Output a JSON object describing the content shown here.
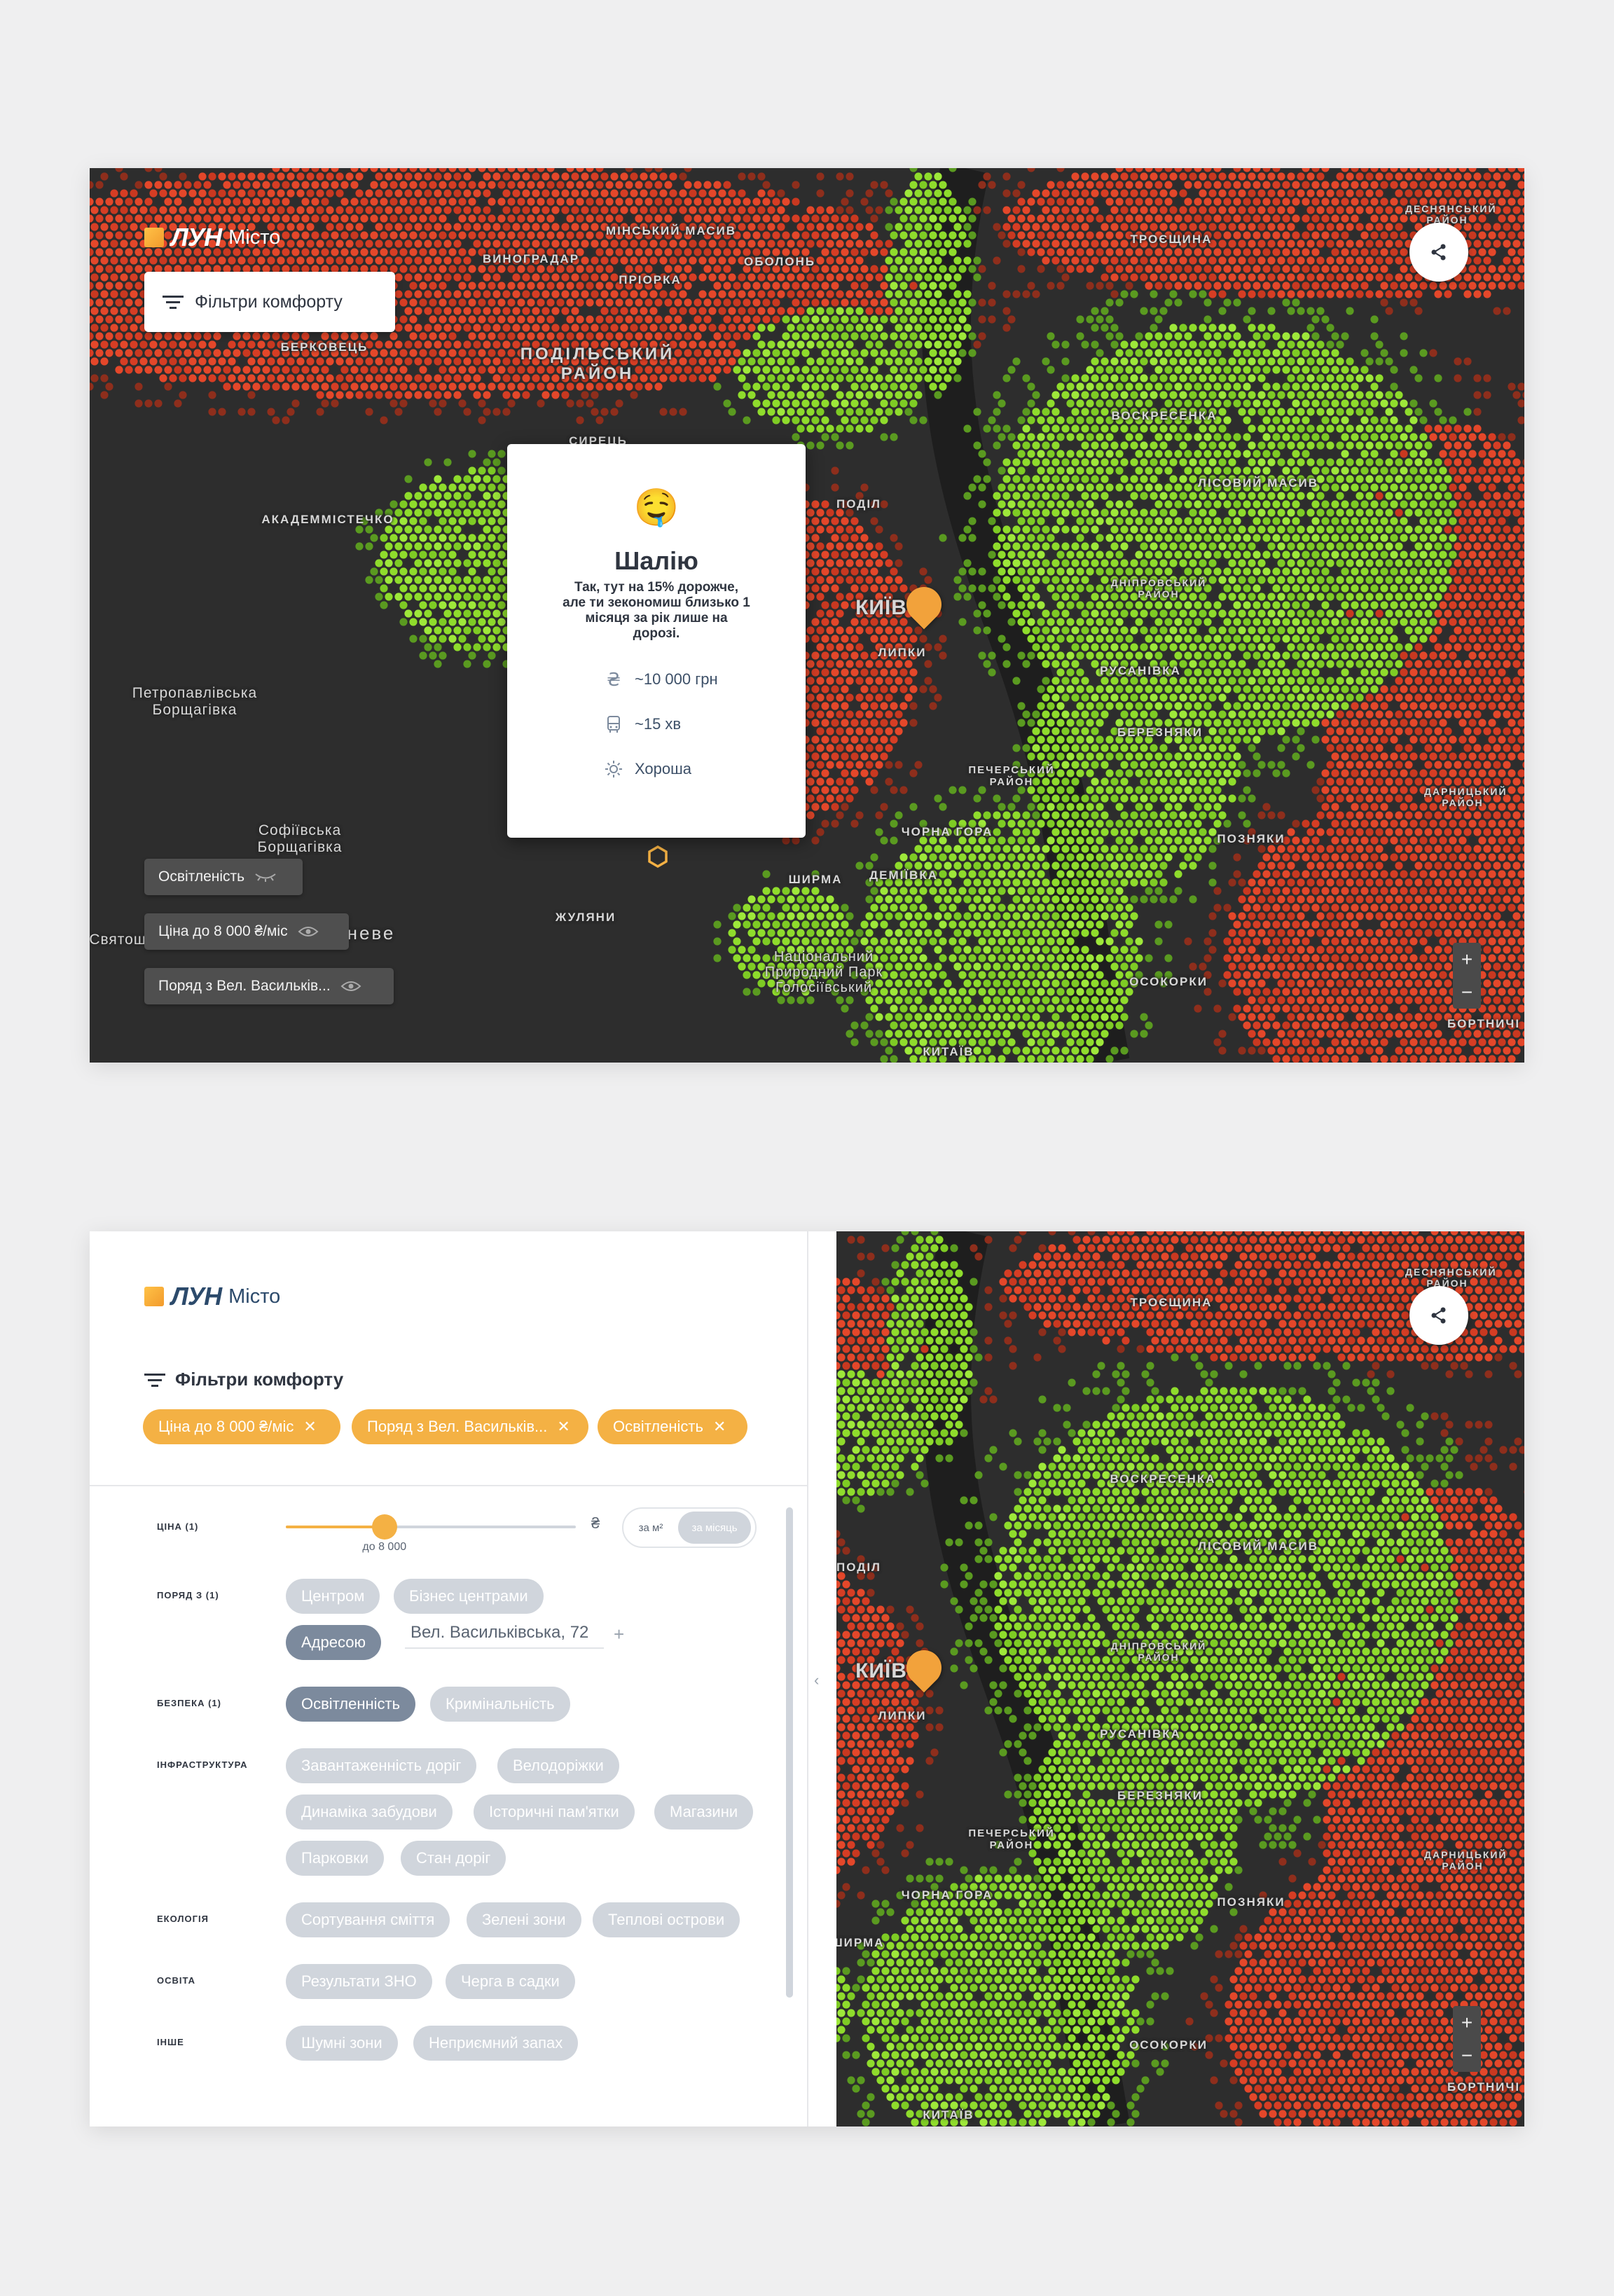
{
  "colors": {
    "accent": "#f4b144",
    "map_bg": "#2b2b2b",
    "high": "#e5492a",
    "low": "#8bdb2a"
  },
  "top": {
    "logo": {
      "brand": "ЛУН",
      "sub": "Місто"
    },
    "filters_button": "Фільтри комфорту",
    "popup": {
      "emoji": "🤤",
      "title": "Шалію",
      "desc": "Так, тут на 15% дорожче, але ти зекономиш близько 1 місяця за рік лише на дорозі.",
      "price": "~10 000 грн",
      "transit": "~15 хв",
      "light": "Хороша"
    },
    "layers": [
      "Освітленість",
      "Ціна до 8 000 ₴/міс",
      "Поряд з Вел. Васильків..."
    ],
    "labels": {
      "minsk": "Мінський масив",
      "obolon": "Оболонь",
      "vynohradar": "Виноградар",
      "priorka": "Пріорка",
      "podilskyi": "Подільський район",
      "berkovets": "Берковець",
      "syrets": "Сирець",
      "akadem": "Академмістечко",
      "podil": "Поділ",
      "kyiv": "Київ",
      "lypky": "Липки",
      "troieshchyna": "Троєщина",
      "voskresenka": "Воскресенка",
      "lisovyi": "Лісовий масив",
      "dniprovskyi": "Дніпровський район",
      "rusanivka": "Русанівка",
      "berezniaky": "Березняки",
      "pecherskyi": "Печерський район",
      "chorna": "Чорна гора",
      "shyrma": "Ширма",
      "demiivka": "Деміївка",
      "zhuliany": "Жуляни",
      "pozniaky": "Позняки",
      "darnytskyi": "Дарницький район",
      "desnianskyi": "Деснянський район",
      "osokorky": "Осокорки",
      "bortnychi": "Бортничі",
      "kytaiv": "Китаїв",
      "petro": "Петропавлівська Борщагівка",
      "sofia": "Софіївська Борщагівка",
      "sviatoshyn": "Святош",
      "vyshneve": "неве",
      "park": "Національний Природний Парк Голосіївський"
    }
  },
  "bottom": {
    "logo": {
      "brand": "ЛУН",
      "sub": "Місто"
    },
    "filters_title": "Фільтри комфорту",
    "active_filters": [
      "Ціна до 8 000 ₴/міс",
      "Поряд з Вел. Васильків...",
      "Освітленість"
    ],
    "rows": {
      "price": "ЦІНА (1)",
      "near": "ПОРЯД З (1)",
      "safety": "БЕЗПЕКА (1)",
      "infra": "ІНФРАСТРУКТУРА",
      "ecology": "ЕКОЛОГІЯ",
      "education": "ОСВІТА",
      "other": "ІНШЕ"
    },
    "slider": {
      "value_label": "до 8 000",
      "fraction": 0.34,
      "currency": "₴"
    },
    "toggle": {
      "per_m2": "за м²",
      "per_month": "за місяць"
    },
    "near_options": [
      "Центром",
      "Бізнес центрами",
      "Адресою"
    ],
    "address_value": "Вел. Васильківська, 72",
    "safety_options": [
      "Освітленність",
      "Кримінальність"
    ],
    "infra_options": [
      "Завантаженність доріг",
      "Велодоріжки",
      "Динаміка забудови",
      "Історичні пам'ятки",
      "Магазини",
      "Парковки",
      "Стан доріг"
    ],
    "ecology_options": [
      "Сортування сміття",
      "Зелені зони",
      "Теплові острови"
    ],
    "education_options": [
      "Результати ЗНО",
      "Черга в садки"
    ],
    "other_options": [
      "Шумні зони",
      "Неприємний запах"
    ],
    "map_labels": {
      "troieshchyna": "Троєщина",
      "voskresenka": "Воскресенка",
      "podil": "Поділ",
      "kyiv": "Київ",
      "lypky": "Липки",
      "lisovyi": "Лісовий масив",
      "dniprovskyi": "Дніпровський район",
      "rusanivka": "Русанівка",
      "berezniaky": "Березняки",
      "pecherskyi": "Печерський район",
      "chorna": "Чорна гора",
      "pozniaky": "Позняки",
      "darnytskyi": "Дарницький район",
      "desnianskyi": "Деснянський район",
      "osokorky": "Осокорки",
      "bortnychi": "Бортничі",
      "kytaiv": "Китаїв",
      "shyrma": "Ширма"
    }
  }
}
